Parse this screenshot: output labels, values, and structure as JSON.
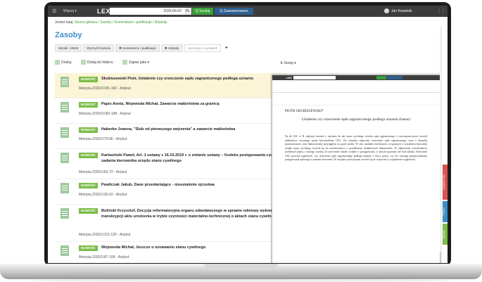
{
  "topbar": {
    "menu_icon": "hamburger-icon",
    "more_label": "Więcej ▾",
    "logo": "LEX",
    "search_value": "2025-06-02",
    "lang": "PL",
    "search_button": "Q Szukaj",
    "advanced_button": "Q Zaawansowane",
    "user_name": "Jan Kowalski"
  },
  "breadcrumb": {
    "prefix": "Jesteś tutaj:",
    "path": "Strona główna / Zasoby / Komentarze i publikacje / Artykuły"
  },
  "page_title": "Zasoby",
  "filters": [
    "Wyniki: 13615",
    "Wyczyść kryteria",
    "✖ Komentarze i publikacje",
    "✖ Artykuły",
    "wyszukaj w wynikach",
    "✚"
  ],
  "toolbar": {
    "print": "Drukuj",
    "add_folder": "Dodaj do folderu",
    "save_as": "Zapisz jako ▾",
    "sort": "Sortuj ▾"
  },
  "badge": "NOWOŚĆ",
  "results": [
    {
      "title": "Skubiszewski Piotr, Ustalenie czy orzeczenie sądu zagranicznego podlega uznaniu",
      "meta": "Metryka.2020/2/181-182 - Artykuł",
      "active": true
    },
    {
      "title": "Papis Aneta, Wojewoda Michał, Zawarcie małżeństwa za granicą",
      "meta": "Metryka.2020/2/183-188 - Artykuł"
    },
    {
      "title": "Haberko Joanna, \"Ślub od pierwszego wejrzenia\" a zawarcie małżeństwa",
      "meta": "Metryka.2020/1/73-86 - Artykuł"
    },
    {
      "title": "Kartasiński Paweł, Art. 1 ustawy z 16.10.2019 r. o zmianie ustawy – Kodeks postępowania cywilnego a zadania kierownika urzędu stanu cywilnego",
      "meta": "Metryka.2020/1/63-72 - Artykuł"
    },
    {
      "title": "Pawliczak Jakub, Dane przesłaniające - nieustalenie ojcostwa",
      "meta": "Metryka.2020/1/39-62 - Artykuł"
    },
    {
      "title": "Buliński Krzysztof, Decyzja reformatoryjna organu odwoławczego w sprawie odmowy wykonania transkrypcji aktu urodzenia w tryble czynności materialno-technicznej o aktach stanu cywilnego",
      "meta": "Metryka.2020/1/115-126 - Artykuł"
    },
    {
      "title": "Wojewoda Michał, Jeszcze o uznawaniu stanu cywilnego",
      "meta": "Metryka.2020/1/87-108 - Artykuł"
    }
  ],
  "viewer": {
    "logo": "LEX",
    "author": "PIOTR SKUBISZEWSKI*",
    "doc_title": "Ustalenie czy orzeczenie sądu zagranicznego podlega uznaniu (kasus)",
    "body": "Na tle USC w R. wpłynął wniosek o wpisanie do akt stanu cywilnego wyroku sądu zagranicznego o rozwiązaniu przez rozwód małżeństwa zawartego przed kierownikiem USC. Do wniosku załączono orzeczenie sądu zagranicznego wraz z klauzulą prawomocności oraz tłumaczeniem przysięgłym na język polski. W celu ustalenia okoliczności związanych z wnioskiem kierownik urzędu stanu cywilnego zwrócił się do wnioskodawcy o przedłożenie dodatkowych dokumentów. W odpowiedzi wnioskodawca przedłożył pismo, z którego wynika, że orzeczenie zostało wydane w postępowaniu, w którym pozwany nie brał udziału. Kierownik USC powziął wątpliwość, czy orzeczenie sądu zagranicznego podlega uznaniu z mocy prawa, czy też wymaga przeprowadzenia postępowania sądowego o uznanie orzeczenia. W związku z powyższym zwrócił się do wojewody o wyjaśnienie wątpliwości."
  },
  "side_tabs": [
    "Leksykon LEX",
    "Pomoc",
    "Ankieta"
  ]
}
